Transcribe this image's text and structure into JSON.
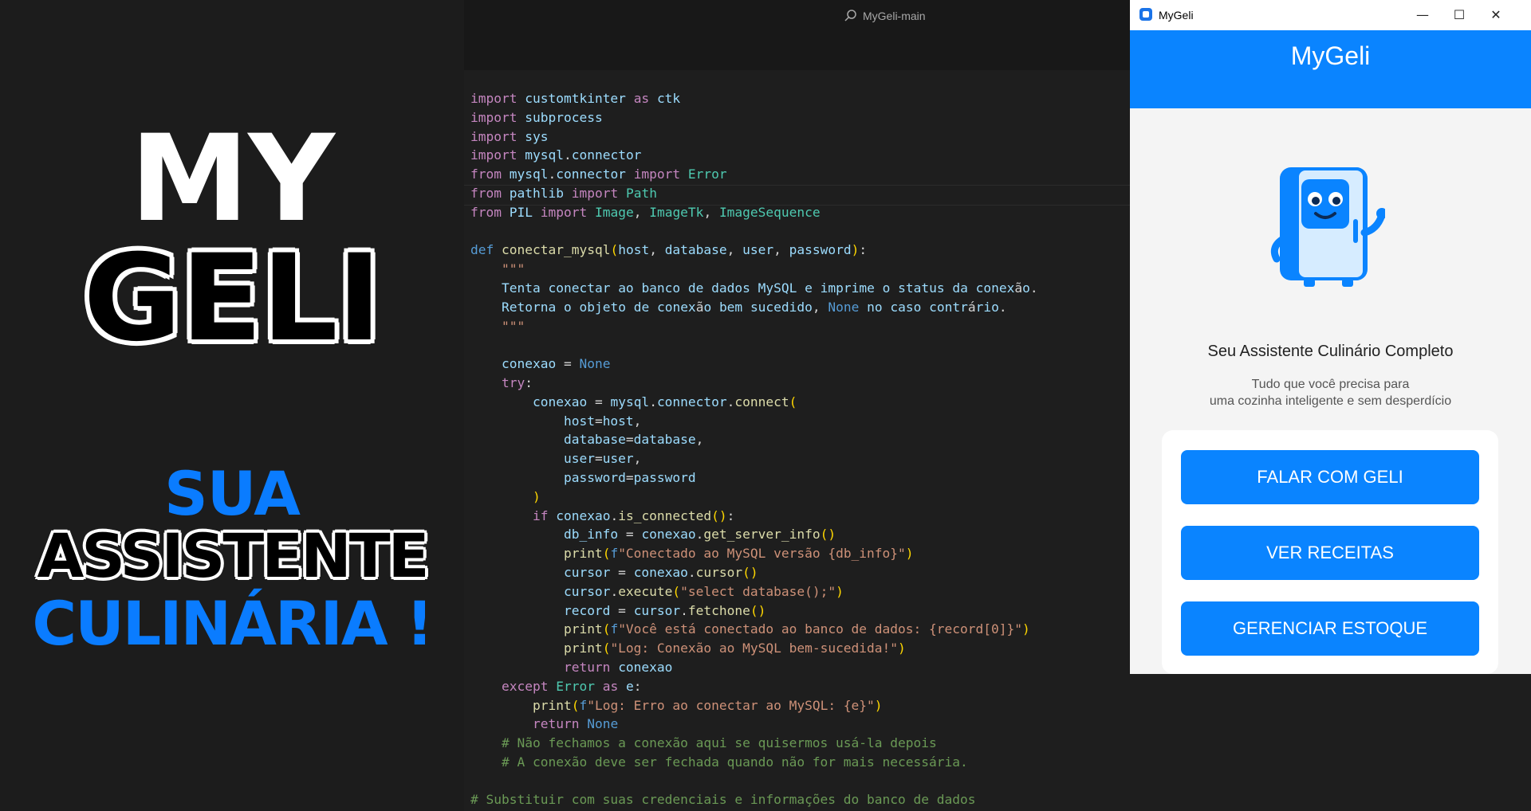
{
  "promo": {
    "line1": "MY",
    "line2": "GELI",
    "line3": "SUA",
    "line4": "ASSISTENTE",
    "line5": "CULINÁRIA !"
  },
  "editor": {
    "title": "MyGeli-main",
    "code": [
      "import customtkinter as ctk",
      "import subprocess",
      "import sys",
      "import mysql.connector",
      "from mysql.connector import Error",
      "from pathlib import Path",
      "from PIL import Image, ImageTk, ImageSequence",
      "",
      "def conectar_mysql(host, database, user, password):",
      "    \"\"\"",
      "    Tenta conectar ao banco de dados MySQL e imprime o status da conexão.",
      "    Retorna o objeto de conexão bem sucedido, None no caso contrário.",
      "    \"\"\"",
      "",
      "    conexao = None",
      "    try:",
      "        conexao = mysql.connector.connect(",
      "            host=host,",
      "            database=database,",
      "            user=user,",
      "            password=password",
      "        )",
      "        if conexao.is_connected():",
      "            db_info = conexao.get_server_info()",
      "            print(f\"Conectado ao MySQL versão {db_info}\")",
      "            cursor = conexao.cursor()",
      "            cursor.execute(\"select database();\")",
      "            record = cursor.fetchone()",
      "            print(f\"Você está conectado ao banco de dados: {record[0]}\")",
      "            print(\"Log: Conexão ao MySQL bem-sucedida!\")",
      "            return conexao",
      "    except Error as e:",
      "        print(f\"Log: Erro ao conectar ao MySQL: {e}\")",
      "        return None",
      "    # Não fechamos a conexão aqui se quisermos usá-la depois",
      "    # A conexão deve ser fechada quando não for mais necessária.",
      "",
      "# Substituir com suas credenciais e informações do banco de dados"
    ]
  },
  "app": {
    "window_title": "MyGeli",
    "header_title": "MyGeli",
    "tagline": "Seu Assistente Culinário Completo",
    "description_line1": "Tudo que você precisa para",
    "description_line2": "uma cozinha inteligente e sem desperdício",
    "buttons": {
      "falar": "FALAR COM GELI",
      "receitas": "VER RECEITAS",
      "estoque": "GERENCIAR ESTOQUE"
    },
    "accent_color": "#0a84ff"
  }
}
